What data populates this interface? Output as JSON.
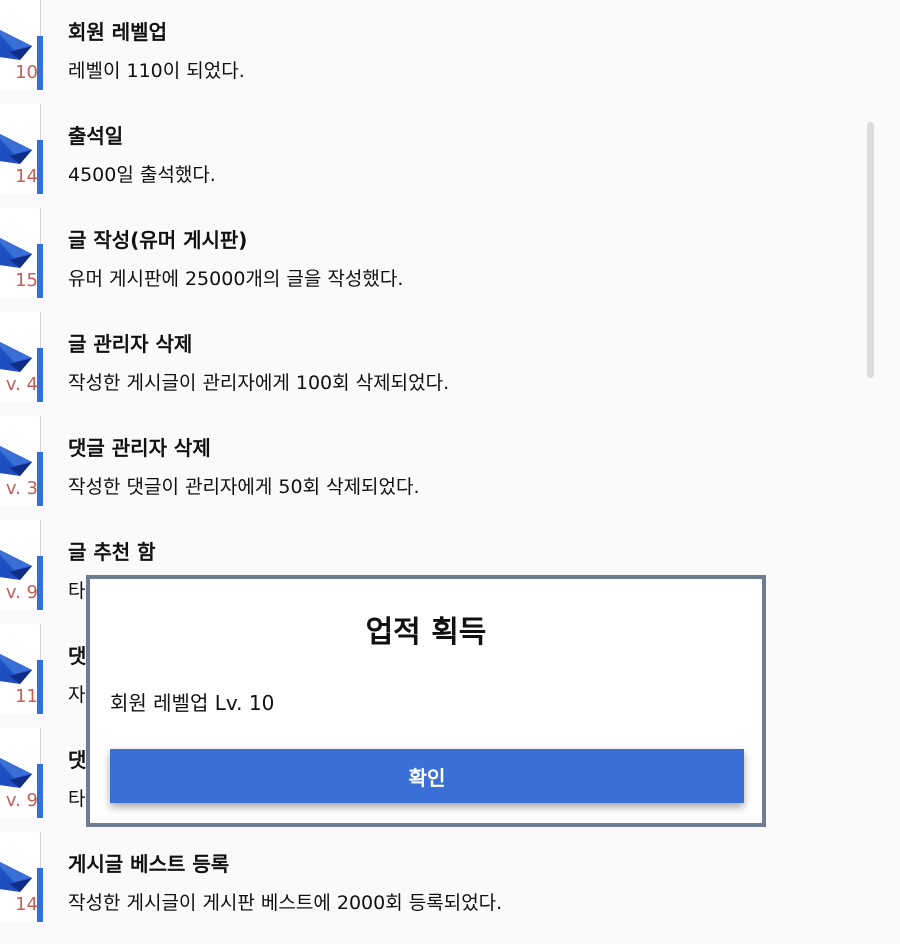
{
  "achievements": [
    {
      "title": "회원 레벨업",
      "desc": "레벨이 110이 되었다.",
      "level": "10"
    },
    {
      "title": "출석일",
      "desc": "4500일 출석했다.",
      "level": "14"
    },
    {
      "title": "글 작성(유머 게시판)",
      "desc": "유머 게시판에 25000개의 글을 작성했다.",
      "level": "15"
    },
    {
      "title": "글 관리자 삭제",
      "desc": "작성한 게시글이 관리자에게 100회 삭제되었다.",
      "level": "v. 4"
    },
    {
      "title": "댓글 관리자 삭제",
      "desc": "작성한 댓글이 관리자에게 50회 삭제되었다.",
      "level": "v. 3"
    },
    {
      "title": "글 추천 함",
      "desc": "타",
      "level": "v. 9"
    },
    {
      "title": "댓",
      "desc": "자",
      "level": "11"
    },
    {
      "title": "댓",
      "desc": "타",
      "level": "v. 9"
    },
    {
      "title": "게시글 베스트 등록",
      "desc": "작성한 게시글이 게시판 베스트에 2000회 등록되었다.",
      "level": "14"
    }
  ],
  "dialog": {
    "title": "업적 획득",
    "message": "회원 레벨업 Lv. 10",
    "confirm_label": "확인"
  },
  "colors": {
    "accent": "#3a6fd6",
    "badge_blue": "#1e4fc2",
    "level_text": "#c0605a",
    "dialog_border": "#6f7d94"
  },
  "icons": {
    "achievement_badge": "envelope-badge-icon"
  }
}
